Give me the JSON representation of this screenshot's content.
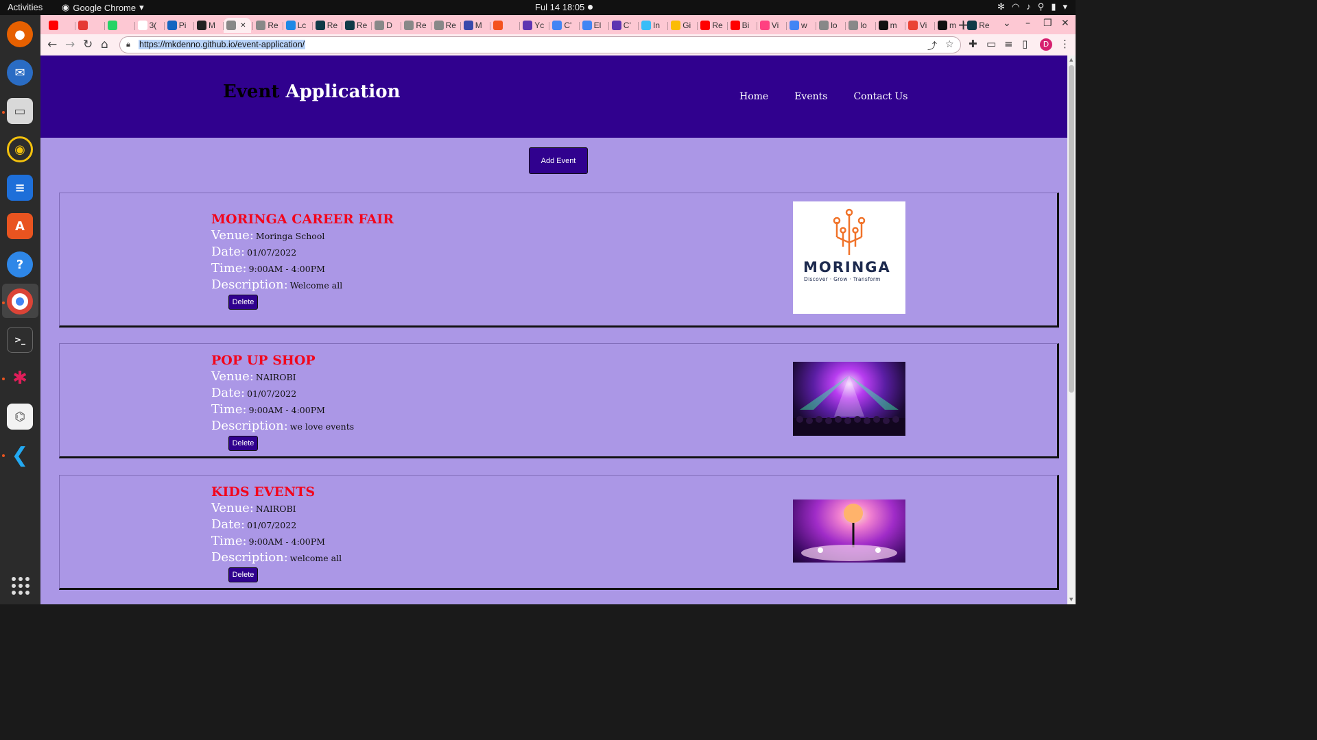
{
  "os": {
    "activities": "Activities",
    "app_name": "Google Chrome",
    "clock": "Ful 14  18:05"
  },
  "browser": {
    "tabs": [
      {
        "label": "",
        "color": "#ff0000"
      },
      {
        "label": "",
        "color": "#e53935"
      },
      {
        "label": "",
        "color": "#25d366"
      },
      {
        "label": "3(",
        "color": "#ffffff"
      },
      {
        "label": "Pi",
        "color": "#1565c0"
      },
      {
        "label": "M",
        "color": "#222222"
      },
      {
        "label": "",
        "color": "#888888",
        "active": true
      },
      {
        "label": "Re",
        "color": "#888888"
      },
      {
        "label": "Lc",
        "color": "#1e88e5"
      },
      {
        "label": "Re",
        "color": "#0f3a47"
      },
      {
        "label": "Re",
        "color": "#0f3a47"
      },
      {
        "label": "D",
        "color": "#888888"
      },
      {
        "label": "Re",
        "color": "#888888"
      },
      {
        "label": "Re",
        "color": "#888888"
      },
      {
        "label": "M",
        "color": "#3949ab"
      },
      {
        "label": "",
        "color": "#f4511e"
      },
      {
        "label": "Yc",
        "color": "#5e35b1"
      },
      {
        "label": "C'",
        "color": "#4285f4"
      },
      {
        "label": "El",
        "color": "#4285f4"
      },
      {
        "label": "C'",
        "color": "#5e35b1"
      },
      {
        "label": "In",
        "color": "#38bdf8"
      },
      {
        "label": "Gi",
        "color": "#fbbc05"
      },
      {
        "label": "Re",
        "color": "#ff0000"
      },
      {
        "label": "Bi",
        "color": "#ff0000"
      },
      {
        "label": "Vi",
        "color": "#ff4081"
      },
      {
        "label": "w",
        "color": "#4285f4"
      },
      {
        "label": "lo",
        "color": "#888888"
      },
      {
        "label": "lo",
        "color": "#888888"
      },
      {
        "label": "m",
        "color": "#111111"
      },
      {
        "label": "Vi",
        "color": "#ea4335"
      },
      {
        "label": "m",
        "color": "#111111"
      },
      {
        "label": "Re",
        "color": "#0f3a47"
      }
    ],
    "url": "https://mkdenno.github.io/event-application/",
    "profile_initial": "D"
  },
  "site": {
    "title_word1": "Event",
    "title_word2": "Application",
    "nav": [
      "Home",
      "Events",
      "Contact Us"
    ],
    "add_event_label": "Add Event",
    "labels": {
      "venue": "Venue:",
      "date": "Date:",
      "time": "Time:",
      "description": "Description:",
      "delete": "Delete"
    },
    "events": [
      {
        "title": "MORINGA CAREER FAIR",
        "venue": "Moringa School",
        "date": "01/07/2022",
        "time": "9:00AM - 4:00PM",
        "description": "Welcome all",
        "image": "moringa-logo",
        "logo_text": "MORINGA",
        "logo_tagline": "Discover · Grow · Transform"
      },
      {
        "title": "POP UP SHOP",
        "venue": "NAIROBI",
        "date": "01/07/2022",
        "time": "9:00AM - 4:00PM",
        "description": "we love events",
        "image": "concert-photo"
      },
      {
        "title": "KIDS EVENTS",
        "venue": "NAIROBI",
        "date": "01/07/2022",
        "time": "9:00AM - 4:00PM",
        "description": "welcome all",
        "image": "banquet-photo"
      }
    ]
  }
}
